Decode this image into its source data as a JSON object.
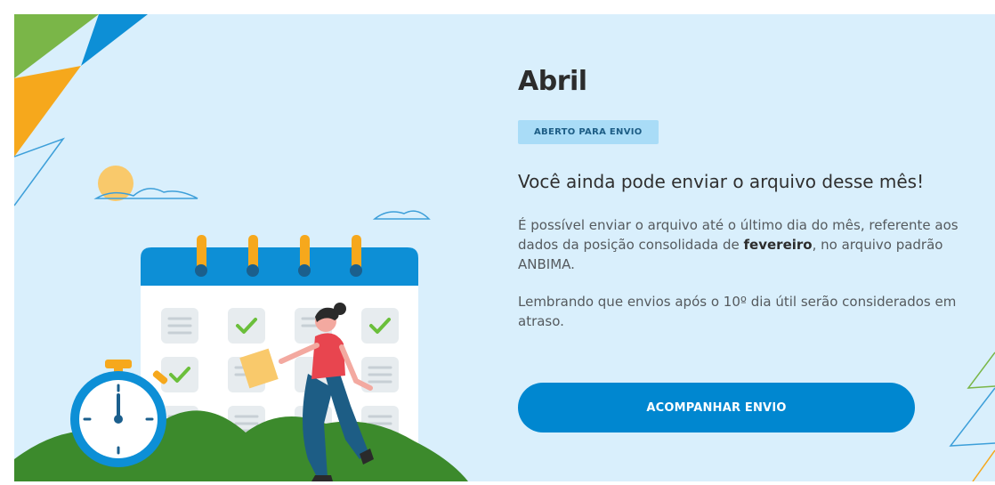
{
  "card": {
    "month_title": "Abril",
    "status_badge": "ABERTO PARA ENVIO",
    "subtitle": "Você ainda pode enviar o arquivo desse mês!",
    "paragraph1": {
      "text_before": "É possível enviar o arquivo até o último dia do mês, referente aos dados da posição consolidada de ",
      "highlight": "fevereiro",
      "text_after": ", no arquivo padrão ANBIMA."
    },
    "paragraph2": "Lembrando que envios após o 10º dia útil serão considerados em atraso.",
    "cta_label": "ACOMPANHAR ENVIO"
  },
  "colors": {
    "background": "#d9effc",
    "accent_blue": "#0087d0",
    "badge_bg": "#a9dcf7",
    "brand_green": "#7ab648",
    "brand_orange": "#f6a81c",
    "hill_green": "#3c8a2c"
  },
  "icons": [
    "calendar-illustration",
    "stopwatch-icon",
    "check-icon",
    "sun-icon",
    "cloud-icon",
    "person-illustration"
  ]
}
